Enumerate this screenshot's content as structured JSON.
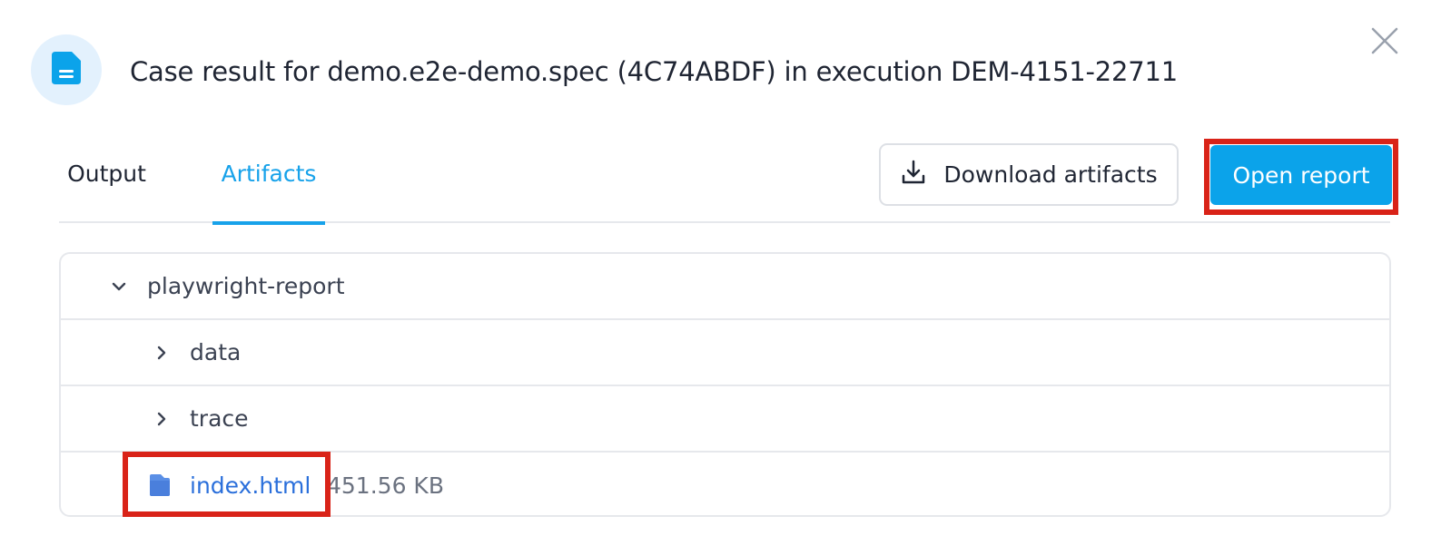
{
  "header": {
    "icon": "document-icon",
    "title": "Case result for demo.e2e-demo.spec (4C74ABDF) in execution DEM-4151-22711",
    "close_icon": "close-icon"
  },
  "tabs": [
    {
      "label": "Output",
      "active": false
    },
    {
      "label": "Artifacts",
      "active": true
    }
  ],
  "actions": {
    "download_label": "Download artifacts",
    "download_icon": "download-icon",
    "open_report_label": "Open report"
  },
  "tree": {
    "folder": {
      "name": "playwright-report",
      "expanded": true
    },
    "children": [
      {
        "name": "data",
        "type": "folder",
        "expanded": false
      },
      {
        "name": "trace",
        "type": "folder",
        "expanded": false
      },
      {
        "name": "index.html",
        "type": "file",
        "size": "451.56 KB",
        "icon": "file-icon"
      }
    ]
  },
  "colors": {
    "accent": "#0ba3ea",
    "highlight": "#d92318",
    "link": "#2a6fdb",
    "icon_bg": "#e3f1fd"
  }
}
